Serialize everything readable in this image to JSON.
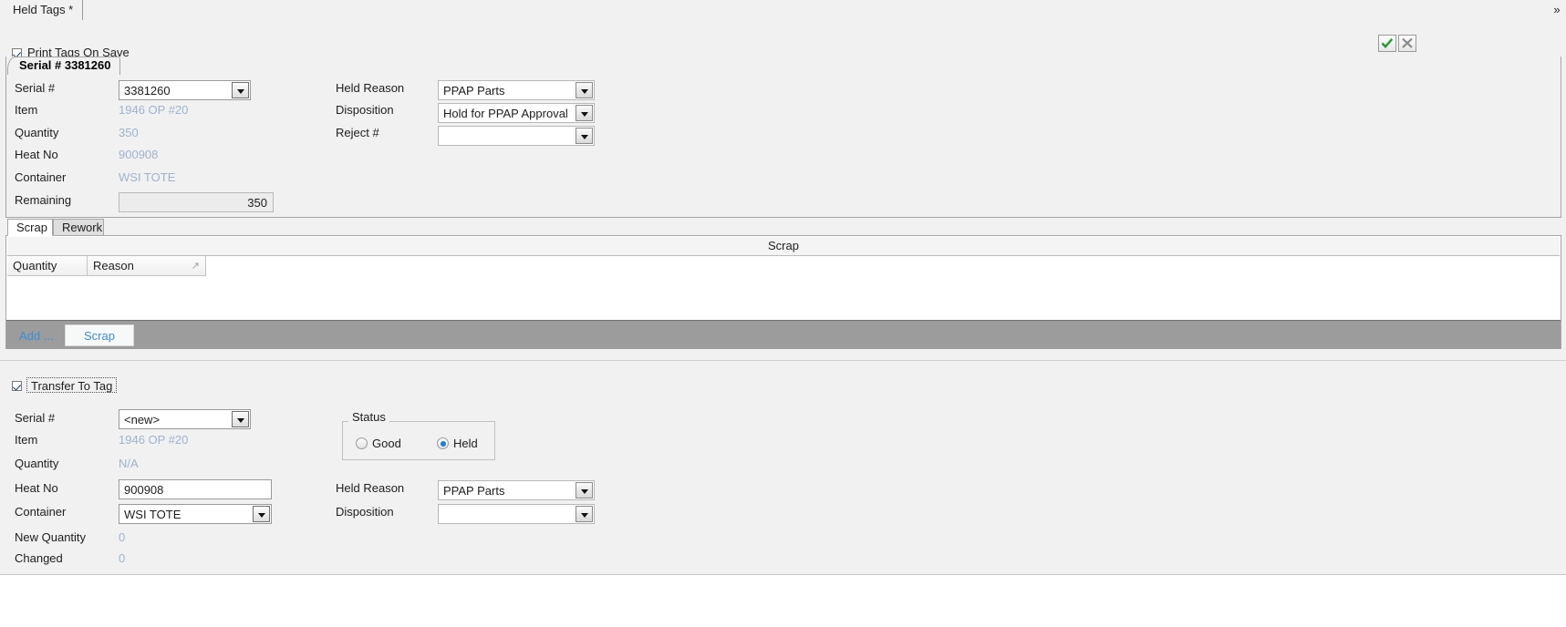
{
  "window": {
    "top_tab_label": "Held Tags *",
    "expand_caret": "»"
  },
  "toolbar": {
    "print_tags_label": "Print Tags On Save",
    "print_tags_checked": true,
    "accept_icon": "check-icon",
    "cancel_icon": "close-icon",
    "accept_color": "#1e9e2e",
    "cancel_color": "#8a8a8a"
  },
  "serial_panel": {
    "tab_title": "Serial # 3381260",
    "left_fields": [
      {
        "label": "Serial #",
        "value": "3381260",
        "kind": "combo"
      },
      {
        "label": "Item",
        "value": "1946 OP #20",
        "kind": "readonly"
      },
      {
        "label": "Quantity",
        "value": "350",
        "kind": "readonly"
      },
      {
        "label": "Heat No",
        "value": "900908",
        "kind": "readonly"
      },
      {
        "label": "Container",
        "value": "WSI TOTE",
        "kind": "readonly"
      },
      {
        "label": "Remaining",
        "value": "350",
        "kind": "readonly-box"
      }
    ],
    "right_fields": [
      {
        "label": "Held Reason",
        "value": "PPAP Parts"
      },
      {
        "label": "Disposition",
        "value": "Hold for PPAP Approval"
      },
      {
        "label": "Reject #",
        "value": ""
      }
    ]
  },
  "scrap_section": {
    "tabs": [
      {
        "label": "Scrap",
        "active": true
      },
      {
        "label": "Rework",
        "active": false
      }
    ],
    "grid_caption": "Scrap",
    "columns": [
      {
        "label": "Quantity",
        "sorted": false
      },
      {
        "label": "Reason",
        "sorted": true
      }
    ],
    "rows": [],
    "add_button": "Add ...",
    "scrap_button": "Scrap"
  },
  "transfer_section": {
    "checkbox_label": "Transfer To Tag",
    "checkbox_checked": true,
    "left_fields": [
      {
        "label": "Serial #",
        "value": "<new>",
        "kind": "combo"
      },
      {
        "label": "Item",
        "value": "1946 OP #20",
        "kind": "readonly"
      },
      {
        "label": "Quantity",
        "value": "N/A",
        "kind": "readonly"
      },
      {
        "label": "Heat No",
        "value": "900908",
        "kind": "textbox"
      },
      {
        "label": "Container",
        "value": "WSI TOTE",
        "kind": "combo"
      },
      {
        "label": "New Quantity",
        "value": "0",
        "kind": "readonly"
      },
      {
        "label": "Changed",
        "value": "0",
        "kind": "readonly"
      }
    ],
    "status_group": {
      "label": "Status",
      "options": [
        {
          "label": "Good",
          "selected": false
        },
        {
          "label": "Held",
          "selected": true
        }
      ]
    },
    "right_fields": [
      {
        "label": "Held Reason",
        "value": "PPAP Parts"
      },
      {
        "label": "Disposition",
        "value": ""
      }
    ]
  },
  "colors": {
    "readonly_text": "#9fb3cc",
    "link_blue": "#3d8ddd",
    "toolbar_gray": "#9c9c9c",
    "panel_bg": "#f1f1f1"
  }
}
